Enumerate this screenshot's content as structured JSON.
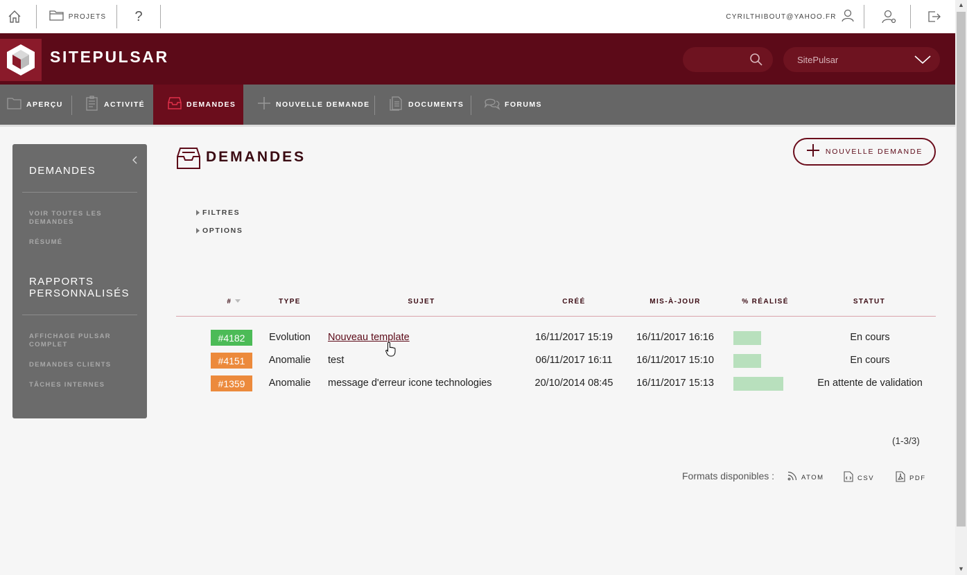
{
  "topbar": {
    "home_icon": "home-icon",
    "projects_label": "PROJETS",
    "help_label": "?",
    "user_email": "CYRILTHIBOUT@YAHOO.FR"
  },
  "header": {
    "brand": "SITEPULSAR",
    "project_select": "SitePulsar",
    "colors": {
      "primary": "#5c0a18",
      "accent": "#8a1a2a"
    }
  },
  "nav": {
    "tabs": [
      {
        "label": "APERÇU",
        "icon": "folder-icon"
      },
      {
        "label": "ACTIVITÉ",
        "icon": "activity-icon"
      },
      {
        "label": "DEMANDES",
        "icon": "inbox-icon",
        "active": true
      },
      {
        "label": "NOUVELLE DEMANDE",
        "icon": "plus-icon"
      },
      {
        "label": "DOCUMENTS",
        "icon": "documents-icon"
      },
      {
        "label": "FORUMS",
        "icon": "forum-icon"
      }
    ]
  },
  "sidebar": {
    "heading1": "DEMANDES",
    "links1": [
      "VOIR TOUTES LES DEMANDES",
      "RÉSUMÉ"
    ],
    "heading2": "RAPPORTS PERSONNALISÉS",
    "links2": [
      "AFFICHAGE PULSAR COMPLET",
      "DEMANDES CLIENTS",
      "TÂCHES INTERNES"
    ]
  },
  "main": {
    "title": "DEMANDES",
    "new_button": "NOUVELLE DEMANDE",
    "filters_label": "FILTRES",
    "options_label": "OPTIONS",
    "columns": [
      "#",
      "TYPE",
      "SUJET",
      "CRÉÉ",
      "MIS-À-JOUR",
      "% RÉALISÉ",
      "STATUT"
    ],
    "issues": [
      {
        "id": "#4182",
        "badge_color": "#4cbb57",
        "type": "Evolution",
        "subject": "Nouveau template",
        "created": "16/11/2017 15:19",
        "updated": "16/11/2017 16:16",
        "done_fraction": 0.56,
        "status": "En cours"
      },
      {
        "id": "#4151",
        "badge_color": "#ec8a3c",
        "type": "Anomalie",
        "subject": "test",
        "created": "06/11/2017 16:11",
        "updated": "16/11/2017 15:10",
        "done_fraction": 0.56,
        "status": "En cours"
      },
      {
        "id": "#1359",
        "badge_color": "#ec8a3c",
        "type": "Anomalie",
        "subject": "message d'erreur icone technologies",
        "created": "20/10/2014 08:45",
        "updated": "16/11/2017 15:13",
        "done_fraction": 1.0,
        "status": "En attente de validation"
      }
    ],
    "pagination": "(1-3/3)",
    "formats_label": "Formats disponibles :",
    "formats": [
      "ATOM",
      "CSV",
      "PDF"
    ]
  }
}
